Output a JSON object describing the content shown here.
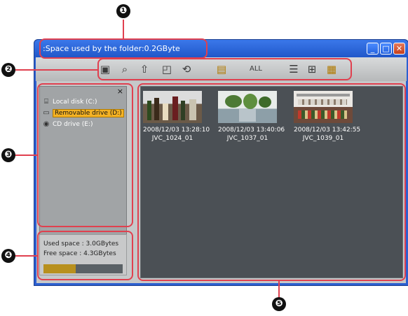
{
  "window": {
    "title": ":Space used by the folder:0.2GByte",
    "controls": {
      "minimize": "_",
      "maximize": "□",
      "close": "✕"
    }
  },
  "toolbar": {
    "icons": [
      "folder-icon",
      "search-icon",
      "up-icon",
      "new-folder-icon",
      "refresh-icon",
      "tree-view-icon",
      "select-all-icon",
      "list-view-icon",
      "details-view-icon",
      "thumbnail-view-icon"
    ],
    "select_all_label": "ALL"
  },
  "sidebar": {
    "close_label": "×",
    "drives": [
      {
        "label": "Local disk (C:)",
        "icon": "hard-disk-icon"
      },
      {
        "label": "Removable drive (D:)",
        "icon": "removable-drive-icon",
        "selected": true
      },
      {
        "label": "CD drive (E:)",
        "icon": "cd-drive-icon"
      }
    ]
  },
  "space": {
    "used": "Used space :  3.0GBytes",
    "free": "Free space :  4.3GBytes",
    "used_fraction": 0.41
  },
  "thumbnails": [
    {
      "date": "2008/12/03 13:28:10",
      "name": "JVC_1024_01"
    },
    {
      "date": "2008/12/03 13:40:06",
      "name": "JVC_1037_01"
    },
    {
      "date": "2008/12/03 13:42:55",
      "name": "JVC_1039_01"
    }
  ],
  "callouts": [
    "❶",
    "❷",
    "❸",
    "❹",
    "❺"
  ],
  "colors": {
    "highlight": "#e0404f",
    "titlebar": "#1f56c8",
    "selection": "#f4b224"
  }
}
